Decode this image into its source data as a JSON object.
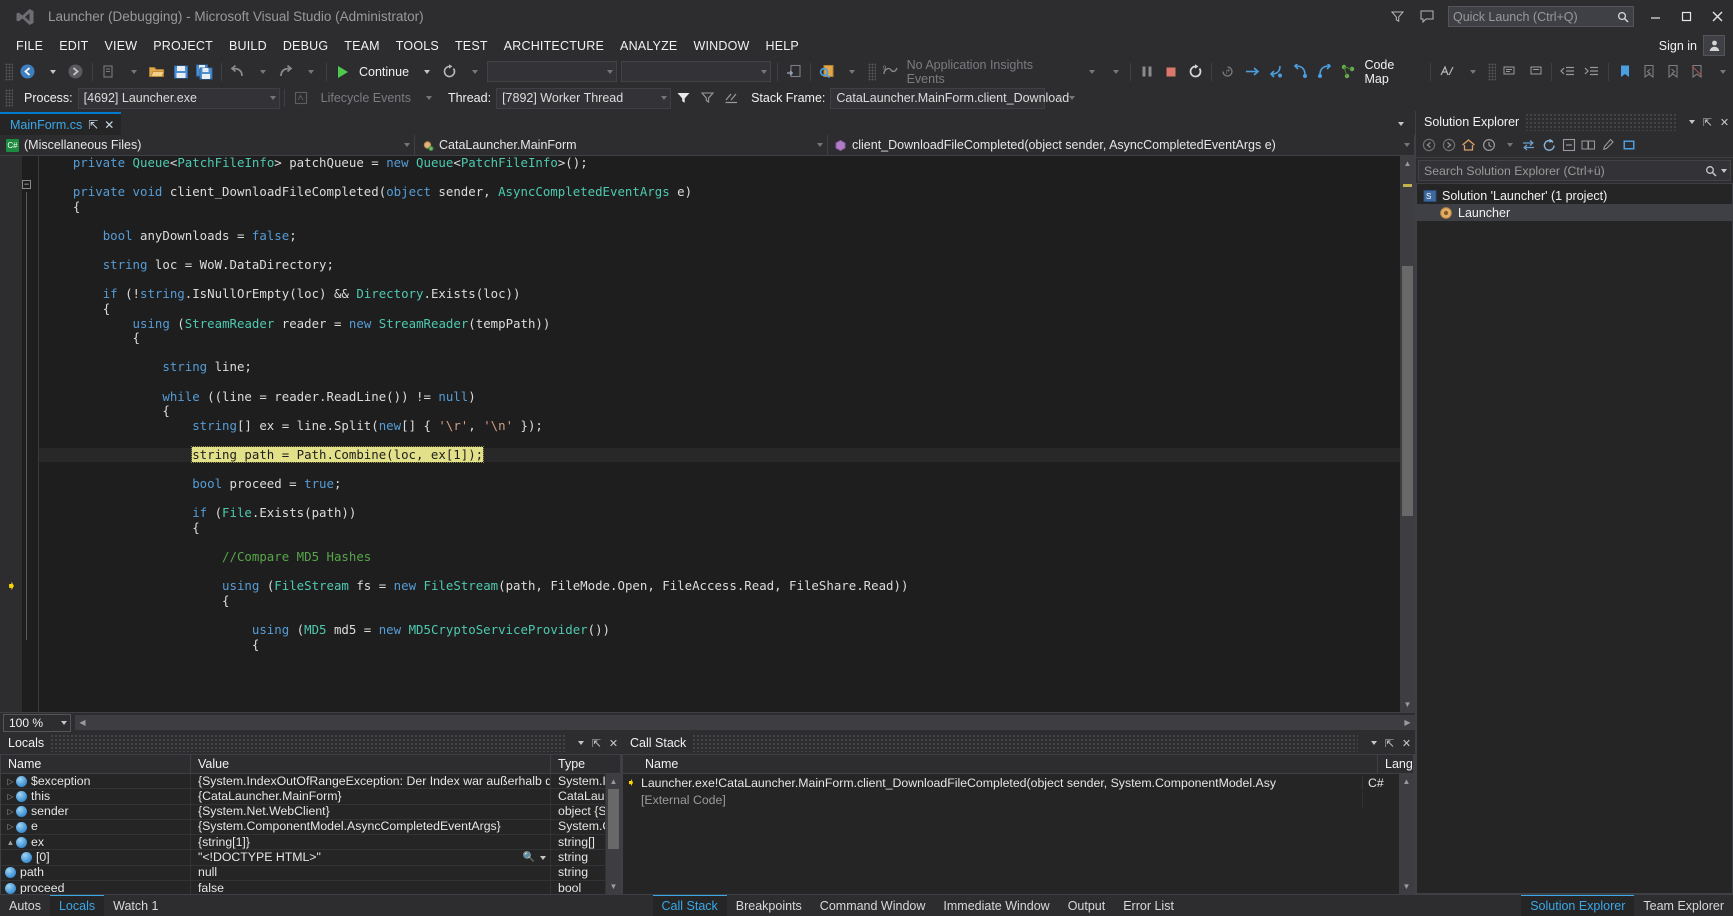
{
  "window": {
    "title": "Launcher (Debugging) - Microsoft Visual Studio (Administrator)",
    "logo_icon": "visual-studio-logo",
    "minimize_icon": "minimize-icon",
    "maximize_icon": "maximize-icon",
    "close_icon": "close-icon",
    "feedback_icon": "feedback-icon",
    "filter_icon": "filter-icon"
  },
  "quick_launch": {
    "placeholder": "Quick Launch (Ctrl+Q)",
    "value": "",
    "search_icon": "magnifier-icon"
  },
  "menu": {
    "items": [
      "FILE",
      "EDIT",
      "VIEW",
      "PROJECT",
      "BUILD",
      "DEBUG",
      "TEAM",
      "TOOLS",
      "TEST",
      "ARCHITECTURE",
      "ANALYZE",
      "WINDOW",
      "HELP"
    ],
    "sign_in": "Sign in",
    "avatar_icon": "user-avatar-icon"
  },
  "toolbar": {
    "nav_back_icon": "navigate-backward-icon",
    "nav_fwd_icon": "navigate-forward-icon",
    "new_item_icon": "new-item-icon",
    "open_icon": "open-file-icon",
    "save_icon": "save-icon",
    "save_all_icon": "save-all-icon",
    "undo_icon": "undo-icon",
    "redo_icon": "redo-icon",
    "continue_label": "Continue",
    "continue_icon": "play-icon",
    "restart_icon": "restart-icon",
    "config_value": "",
    "platform_value": "",
    "attach_icon": "attach-to-process-icon",
    "find_icon": "find-in-files-icon",
    "insights_label": "No Application Insights Events",
    "insights_icon": "app-insights-icon",
    "break_all_icon": "break-all-icon",
    "stop_icon": "stop-debugging-icon",
    "restart_debug_icon": "restart-debugging-icon",
    "show_next_icon": "show-next-statement-icon",
    "step_into_icon": "step-into-icon",
    "step_over_icon": "step-over-icon",
    "step_out_icon": "step-out-icon",
    "code_map_label": "Code Map",
    "code_map_icon": "code-map-icon",
    "intellitrace_icon": "intellitrace-icon",
    "comment_icon": "comment-selection-icon",
    "uncomment_icon": "uncomment-selection-icon",
    "indent_icon": "increase-indent-icon",
    "outdent_icon": "decrease-indent-icon",
    "bookmark_icon": "toggle-bookmark-icon",
    "prev_bookmark_icon": "previous-bookmark-icon",
    "next_bookmark_icon": "next-bookmark-icon",
    "clear_bookmarks_icon": "clear-bookmarks-icon"
  },
  "debug_bar": {
    "process_label": "Process:",
    "process_value": "[4692] Launcher.exe",
    "lifecycle_label": "Lifecycle Events",
    "lifecycle_icon": "lifecycle-events-icon",
    "thread_label": "Thread:",
    "thread_value": "[7892] Worker Thread",
    "flag_icon": "flag-filter-icon",
    "flag_clear_icon": "clear-flag-icon",
    "stackframe_label": "Stack Frame:",
    "stackframe_value": "CataLauncher.MainForm.client_Download"
  },
  "editor": {
    "tab_label": "MainForm.cs",
    "pin_icon": "pin-icon",
    "close_icon": "close-tab-icon",
    "nav_scope": "(Miscellaneous Files)",
    "nav_scope_icon": "csharp-file-icon",
    "nav_type": "CataLauncher.MainForm",
    "nav_type_icon": "class-icon",
    "nav_member": "client_DownloadFileCompleted(object sender, AsyncCompletedEventArgs e)",
    "nav_member_icon": "method-icon",
    "zoom_level": "100 %",
    "breakpoint_arrow_icon": "current-statement-arrow-icon",
    "lines": [
      {
        "indent": 4,
        "tokens": [
          {
            "t": "kw",
            "v": "private "
          },
          {
            "t": "typ",
            "v": "Queue"
          },
          {
            "t": "pln",
            "v": "<"
          },
          {
            "t": "typ",
            "v": "PatchFileInfo"
          },
          {
            "t": "pln",
            "v": "> patchQueue = "
          },
          {
            "t": "kw",
            "v": "new "
          },
          {
            "t": "typ",
            "v": "Queue"
          },
          {
            "t": "pln",
            "v": "<"
          },
          {
            "t": "typ",
            "v": "PatchFileInfo"
          },
          {
            "t": "pln",
            "v": ">();"
          }
        ]
      },
      {
        "indent": 0,
        "tokens": []
      },
      {
        "indent": 4,
        "tokens": [
          {
            "t": "kw",
            "v": "private "
          },
          {
            "t": "kw",
            "v": "void "
          },
          {
            "t": "pln",
            "v": "client_DownloadFileCompleted("
          },
          {
            "t": "kw",
            "v": "object"
          },
          {
            "t": "pln",
            "v": " sender, "
          },
          {
            "t": "typ",
            "v": "AsyncCompletedEventArgs"
          },
          {
            "t": "pln",
            "v": " e)"
          }
        ]
      },
      {
        "indent": 4,
        "tokens": [
          {
            "t": "pln",
            "v": "{"
          }
        ]
      },
      {
        "indent": 0,
        "tokens": []
      },
      {
        "indent": 8,
        "tokens": [
          {
            "t": "kw",
            "v": "bool"
          },
          {
            "t": "pln",
            "v": " anyDownloads = "
          },
          {
            "t": "kw",
            "v": "false"
          },
          {
            "t": "pln",
            "v": ";"
          }
        ]
      },
      {
        "indent": 0,
        "tokens": []
      },
      {
        "indent": 8,
        "tokens": [
          {
            "t": "kw",
            "v": "string"
          },
          {
            "t": "pln",
            "v": " loc = WoW.DataDirectory;"
          }
        ]
      },
      {
        "indent": 0,
        "tokens": []
      },
      {
        "indent": 8,
        "tokens": [
          {
            "t": "kw",
            "v": "if"
          },
          {
            "t": "pln",
            "v": " (!"
          },
          {
            "t": "kw",
            "v": "string"
          },
          {
            "t": "pln",
            "v": ".IsNullOrEmpty(loc) && "
          },
          {
            "t": "typ",
            "v": "Directory"
          },
          {
            "t": "pln",
            "v": ".Exists(loc))"
          }
        ]
      },
      {
        "indent": 8,
        "tokens": [
          {
            "t": "pln",
            "v": "{"
          }
        ]
      },
      {
        "indent": 12,
        "tokens": [
          {
            "t": "kw",
            "v": "using"
          },
          {
            "t": "pln",
            "v": " ("
          },
          {
            "t": "typ",
            "v": "StreamReader"
          },
          {
            "t": "pln",
            "v": " reader = "
          },
          {
            "t": "kw",
            "v": "new"
          },
          {
            "t": "pln",
            "v": " "
          },
          {
            "t": "typ",
            "v": "StreamReader"
          },
          {
            "t": "pln",
            "v": "(tempPath))"
          }
        ]
      },
      {
        "indent": 12,
        "tokens": [
          {
            "t": "pln",
            "v": "{"
          }
        ]
      },
      {
        "indent": 0,
        "tokens": []
      },
      {
        "indent": 16,
        "tokens": [
          {
            "t": "kw",
            "v": "string"
          },
          {
            "t": "pln",
            "v": " line;"
          }
        ]
      },
      {
        "indent": 0,
        "tokens": []
      },
      {
        "indent": 16,
        "tokens": [
          {
            "t": "kw",
            "v": "while"
          },
          {
            "t": "pln",
            "v": " ((line = reader.ReadLine()) != "
          },
          {
            "t": "kw",
            "v": "null"
          },
          {
            "t": "pln",
            "v": ")"
          }
        ]
      },
      {
        "indent": 16,
        "tokens": [
          {
            "t": "pln",
            "v": "{"
          }
        ]
      },
      {
        "indent": 20,
        "tokens": [
          {
            "t": "kw",
            "v": "string"
          },
          {
            "t": "pln",
            "v": "[] ex = line.Split("
          },
          {
            "t": "kw",
            "v": "new"
          },
          {
            "t": "pln",
            "v": "[] { "
          },
          {
            "t": "str",
            "v": "'\\r'"
          },
          {
            "t": "pln",
            "v": ", "
          },
          {
            "t": "str",
            "v": "'\\n'"
          },
          {
            "t": "pln",
            "v": " });"
          }
        ]
      },
      {
        "indent": 0,
        "tokens": []
      },
      {
        "indent": 20,
        "highlight": true,
        "tokens": [
          {
            "t": "hl",
            "v": "string path = Path.Combine(loc, ex[1]);"
          }
        ]
      },
      {
        "indent": 0,
        "tokens": []
      },
      {
        "indent": 20,
        "tokens": [
          {
            "t": "kw",
            "v": "bool"
          },
          {
            "t": "pln",
            "v": " proceed = "
          },
          {
            "t": "kw",
            "v": "true"
          },
          {
            "t": "pln",
            "v": ";"
          }
        ]
      },
      {
        "indent": 0,
        "tokens": []
      },
      {
        "indent": 20,
        "tokens": [
          {
            "t": "kw",
            "v": "if"
          },
          {
            "t": "pln",
            "v": " ("
          },
          {
            "t": "typ",
            "v": "File"
          },
          {
            "t": "pln",
            "v": ".Exists(path))"
          }
        ]
      },
      {
        "indent": 20,
        "tokens": [
          {
            "t": "pln",
            "v": "{"
          }
        ]
      },
      {
        "indent": 0,
        "tokens": []
      },
      {
        "indent": 24,
        "tokens": [
          {
            "t": "cmt",
            "v": "//Compare MD5 Hashes"
          }
        ]
      },
      {
        "indent": 0,
        "tokens": []
      },
      {
        "indent": 24,
        "tokens": [
          {
            "t": "kw",
            "v": "using"
          },
          {
            "t": "pln",
            "v": " ("
          },
          {
            "t": "typ",
            "v": "FileStream"
          },
          {
            "t": "pln",
            "v": " fs = "
          },
          {
            "t": "kw",
            "v": "new"
          },
          {
            "t": "pln",
            "v": " "
          },
          {
            "t": "typ",
            "v": "FileStream"
          },
          {
            "t": "pln",
            "v": "(path, FileMode.Open, FileAccess.Read, FileShare.Read))"
          }
        ]
      },
      {
        "indent": 24,
        "tokens": [
          {
            "t": "pln",
            "v": "{"
          }
        ]
      },
      {
        "indent": 0,
        "tokens": []
      },
      {
        "indent": 28,
        "tokens": [
          {
            "t": "kw",
            "v": "using"
          },
          {
            "t": "pln",
            "v": " ("
          },
          {
            "t": "typ",
            "v": "MD5"
          },
          {
            "t": "pln",
            "v": " md5 = "
          },
          {
            "t": "kw",
            "v": "new"
          },
          {
            "t": "pln",
            "v": " "
          },
          {
            "t": "typ",
            "v": "MD5CryptoServiceProvider"
          },
          {
            "t": "pln",
            "v": "())"
          }
        ]
      },
      {
        "indent": 28,
        "tokens": [
          {
            "t": "pln",
            "v": "{"
          }
        ]
      }
    ]
  },
  "locals": {
    "title": "Locals",
    "dropdown_icon": "chevron-down-icon",
    "pin_icon": "pin-icon",
    "close_icon": "close-icon",
    "columns": [
      "Name",
      "Value",
      "Type"
    ],
    "rows": [
      {
        "expander": true,
        "bubble": true,
        "name": "$exception",
        "value": "{System.IndexOutOfRangeException: Der Index war außerhalb des Arrayber",
        "type": "System.I",
        "magnifier": false
      },
      {
        "expander": true,
        "bubble": true,
        "name": "this",
        "value": "{CataLauncher.MainForm}",
        "type": "CataLau",
        "magnifier": false
      },
      {
        "expander": true,
        "bubble": true,
        "name": "sender",
        "value": "{System.Net.WebClient}",
        "type": "object {S",
        "magnifier": false
      },
      {
        "expander": true,
        "bubble": true,
        "name": "e",
        "value": "{System.ComponentModel.AsyncCompletedEventArgs}",
        "type": "System.C",
        "magnifier": false
      },
      {
        "expander": true,
        "expanded": true,
        "bubble": true,
        "name": "ex",
        "value": "{string[1]}",
        "type": "string[]",
        "magnifier": false
      },
      {
        "child": true,
        "bubble": true,
        "name": "[0]",
        "value": "\"<!DOCTYPE HTML>\"",
        "type": "string",
        "magnifier": true
      },
      {
        "child": false,
        "bubble": true,
        "name": "path",
        "value": "null",
        "type": "string",
        "magnifier": false
      },
      {
        "child": false,
        "bubble": true,
        "name": "proceed",
        "value": "false",
        "type": "bool",
        "magnifier": false
      }
    ]
  },
  "call_stack": {
    "title": "Call Stack",
    "dropdown_icon": "chevron-down-icon",
    "pin_icon": "pin-icon",
    "close_icon": "close-icon",
    "columns": [
      "Name",
      "Lang"
    ],
    "rows": [
      {
        "current": true,
        "arrow_icon": "current-frame-arrow-icon",
        "name": "Launcher.exe!CataLauncher.MainForm.client_DownloadFileCompleted(object sender, System.ComponentModel.Asy",
        "lang": "C#"
      },
      {
        "current": false,
        "name": "[External Code]",
        "lang": "",
        "dim": true
      }
    ]
  },
  "solution_explorer": {
    "title": "Solution Explorer",
    "dropdown_icon": "chevron-down-icon",
    "pin_icon": "pin-icon",
    "close_icon": "close-icon",
    "toolbar_icons": [
      "back-icon",
      "forward-icon",
      "home-icon",
      "pending-changes-icon",
      "sync-with-active-document-icon",
      "refresh-icon",
      "collapse-all-icon",
      "show-all-files-icon",
      "properties-icon",
      "preview-selected-items-icon"
    ],
    "search_placeholder": "Search Solution Explorer (Ctrl+ü)",
    "search_icon": "magnifier-icon",
    "search_caret_icon": "chevron-down-icon",
    "tree": [
      {
        "label": "Solution 'Launcher' (1 project)",
        "icon": "solution-icon",
        "selected": false,
        "depth": 0
      },
      {
        "label": "Launcher",
        "icon": "project-icon",
        "selected": true,
        "depth": 1
      }
    ]
  },
  "status_tabs": {
    "left": [
      "Autos",
      "Locals",
      "Watch 1"
    ],
    "left_active": "Locals",
    "bottom": [
      "Call Stack",
      "Breakpoints",
      "Command Window",
      "Immediate Window",
      "Output",
      "Error List"
    ],
    "bottom_active": "Call Stack",
    "right": [
      "Solution Explorer",
      "Team Explorer"
    ],
    "right_active": "Solution Explorer"
  },
  "colors": {
    "accent": "#007acc",
    "link": "#3aa8e8",
    "highlight": "#e3e08a",
    "chrome": "#2d2d30",
    "editor_bg": "#1e1e1e"
  }
}
